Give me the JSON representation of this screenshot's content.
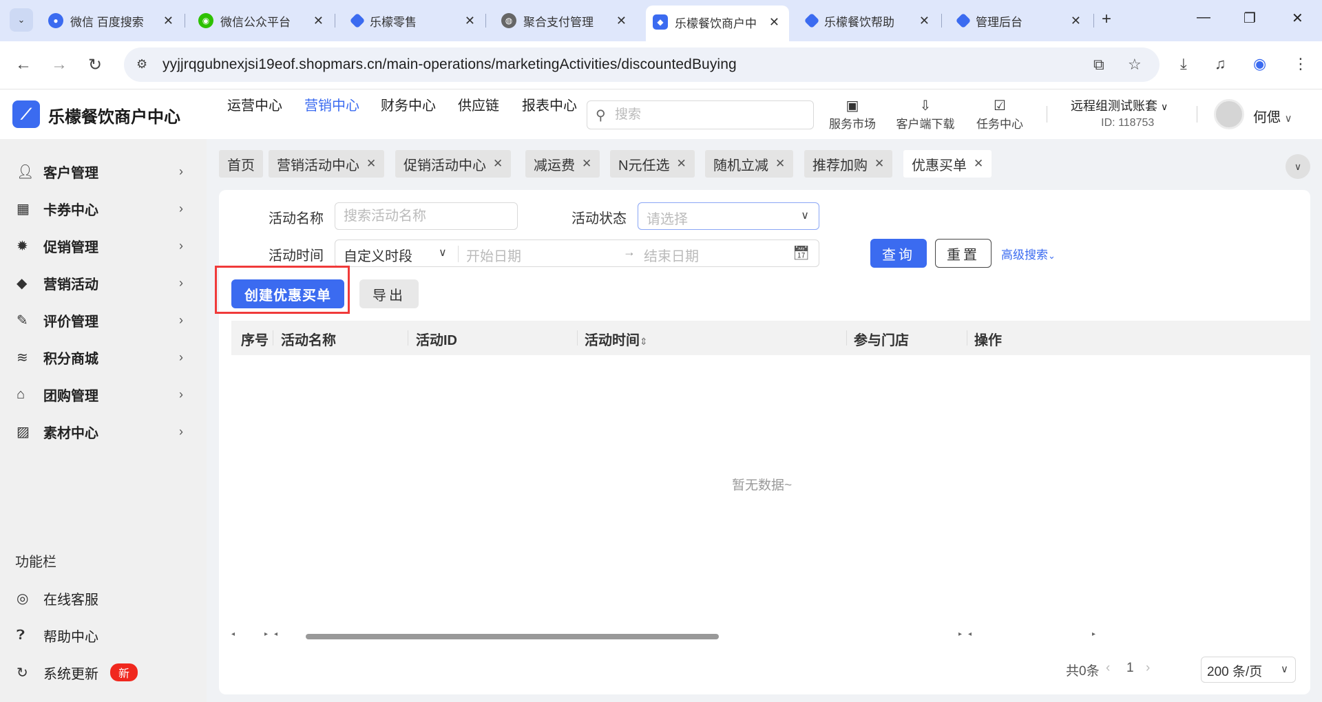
{
  "browser": {
    "tabs": [
      {
        "title": "微信 百度搜索",
        "icon": "baidu-icon",
        "color": "#3b6bf0"
      },
      {
        "title": "微信公众平台",
        "icon": "wechat-icon",
        "color": "#2dc100"
      },
      {
        "title": "乐檬零售",
        "icon": "lemeng-icon",
        "color": "#3b6bf0"
      },
      {
        "title": "聚合支付管理",
        "icon": "globe-icon",
        "color": "#555555"
      },
      {
        "title": "乐檬餐饮商户中心",
        "icon": "lemeng-icon",
        "color": "#3b6bf0"
      },
      {
        "title": "乐檬餐饮帮助",
        "icon": "lemeng-icon",
        "color": "#3b6bf0"
      },
      {
        "title": "管理后台",
        "icon": "lemeng-icon",
        "color": "#3b6bf0"
      }
    ],
    "url": "yyjjrqgubnexjsi19eof.shopmars.cn/main-operations/marketingActivities/discountedBuying"
  },
  "header": {
    "brand": "乐檬餐饮商户中心",
    "nav": [
      "运营中心",
      "营销中心",
      "财务中心",
      "供应链",
      "报表中心"
    ],
    "active_nav": "营销中心",
    "search_placeholder": "搜索",
    "tools": [
      {
        "label": "服务市场",
        "icon": "briefcase-icon"
      },
      {
        "label": "客户端下载",
        "icon": "download-folder-icon"
      },
      {
        "label": "任务中心",
        "icon": "clipboard-check-icon"
      }
    ],
    "account_name": "远程组测试账套",
    "account_id": "ID: 118753",
    "user_name": "何偲"
  },
  "sidebar": {
    "items": [
      {
        "label": "客户管理",
        "icon": "user-icon"
      },
      {
        "label": "卡券中心",
        "icon": "ticket-icon"
      },
      {
        "label": "促销管理",
        "icon": "discount-icon"
      },
      {
        "label": "营销活动",
        "icon": "tag-icon"
      },
      {
        "label": "评价管理",
        "icon": "edit-icon"
      },
      {
        "label": "积分商城",
        "icon": "coins-icon"
      },
      {
        "label": "团购管理",
        "icon": "store-icon"
      },
      {
        "label": "素材中心",
        "icon": "image-icon"
      }
    ],
    "section_title": "功能栏",
    "function_items": [
      {
        "label": "在线客服",
        "icon": "headset-icon"
      },
      {
        "label": "帮助中心",
        "icon": "help-icon"
      },
      {
        "label": "系统更新",
        "icon": "refresh-icon",
        "badge": "新"
      }
    ]
  },
  "page_tabs": [
    "首页",
    "营销活动中心",
    "促销活动中心",
    "减运费",
    "N元任选",
    "随机立减",
    "推荐加购",
    "优惠买单"
  ],
  "active_page_tab": "优惠买单",
  "filters": {
    "name_label": "活动名称",
    "name_placeholder": "搜索活动名称",
    "status_label": "活动状态",
    "status_placeholder": "请选择",
    "time_label": "活动时间",
    "time_mode": "自定义时段",
    "start_placeholder": "开始日期",
    "end_placeholder": "结束日期",
    "query_button": "查询",
    "reset_button": "重置",
    "advanced_search": "高级搜索"
  },
  "actions": {
    "create_button": "创建优惠买单",
    "export_button": "导出"
  },
  "table": {
    "columns": [
      "序号",
      "活动名称",
      "活动ID",
      "活动时间",
      "参与门店",
      "操作"
    ],
    "rows": [],
    "empty_text": "暂无数据~"
  },
  "pagination": {
    "total_text": "共0条",
    "current_page": "1",
    "page_size": "200 条/页"
  },
  "colors": {
    "primary": "#3b6bf0",
    "highlight": "#f03a3a",
    "badge": "#f0281e"
  }
}
